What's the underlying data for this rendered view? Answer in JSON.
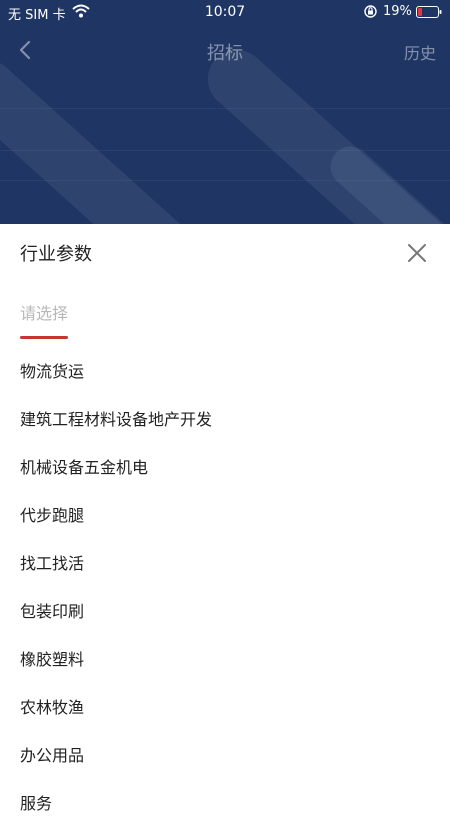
{
  "status_bar": {
    "carrier": "无 SIM 卡",
    "time": "10:07",
    "battery": "19%"
  },
  "nav": {
    "title": "招标",
    "history": "历史"
  },
  "sheet": {
    "title": "行业参数",
    "tab": "请选择",
    "options": [
      "物流货运",
      "建筑工程材料设备地产开发",
      "机械设备五金机电",
      "代步跑腿",
      "找工找活",
      "包装印刷",
      "橡胶塑料",
      "农林牧渔",
      "办公用品",
      "服务"
    ]
  },
  "colors": {
    "header_bg": "#1f3665",
    "accent": "#c8342f",
    "battery_low": "#e0393e"
  },
  "icons": [
    "wifi-icon",
    "lock-icon",
    "battery-icon",
    "back-icon",
    "close-icon"
  ]
}
